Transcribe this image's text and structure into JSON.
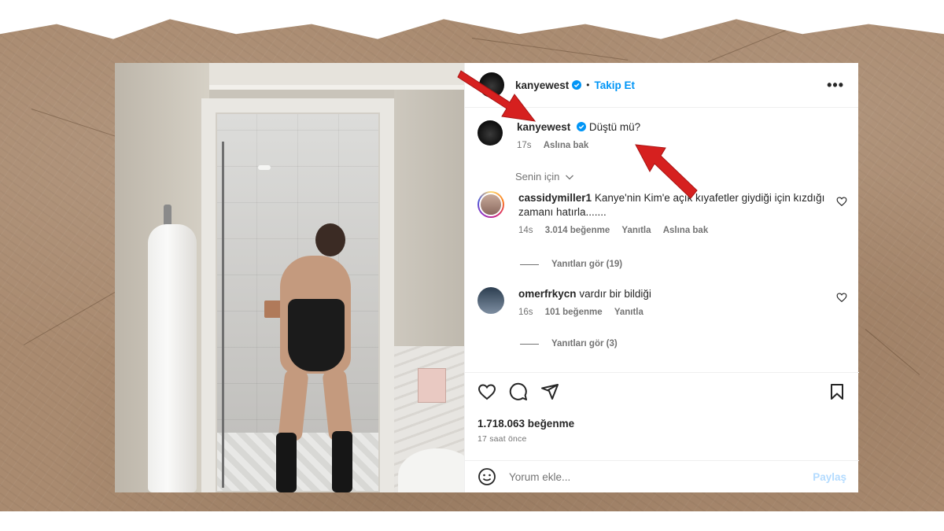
{
  "header": {
    "username": "kanyewest",
    "separator": "•",
    "follow_label": "Takip Et",
    "more_label": "•••"
  },
  "caption": {
    "username": "kanyewest",
    "text": "Düştü mü?",
    "time": "17s",
    "translate": "Aslına bak"
  },
  "for_you": "Senin için",
  "comments": [
    {
      "username": "cassidymiller1",
      "text": "Kanye'nin Kim'e açık kıyafetler giydiği için kızdığı zamanı hatırla.......",
      "time": "14s",
      "likes": "3.014 beğenme",
      "reply": "Yanıtla",
      "translate": "Aslına bak",
      "view_replies": "Yanıtları gör (19)"
    },
    {
      "username": "omerfrkycn",
      "text": "vardır bir bildiği",
      "time": "16s",
      "likes": "101 beğenme",
      "reply": "Yanıtla",
      "view_replies": "Yanıtları gör (3)"
    }
  ],
  "likes_count": "1.718.063 beğenme",
  "time_ago": "17 saat önce",
  "add_comment": {
    "placeholder": "Yorum ekle...",
    "share_label": "Paylaş"
  },
  "colors": {
    "accent": "#0095f6",
    "arrow": "#d6201f",
    "paper": "#a98a6f"
  }
}
